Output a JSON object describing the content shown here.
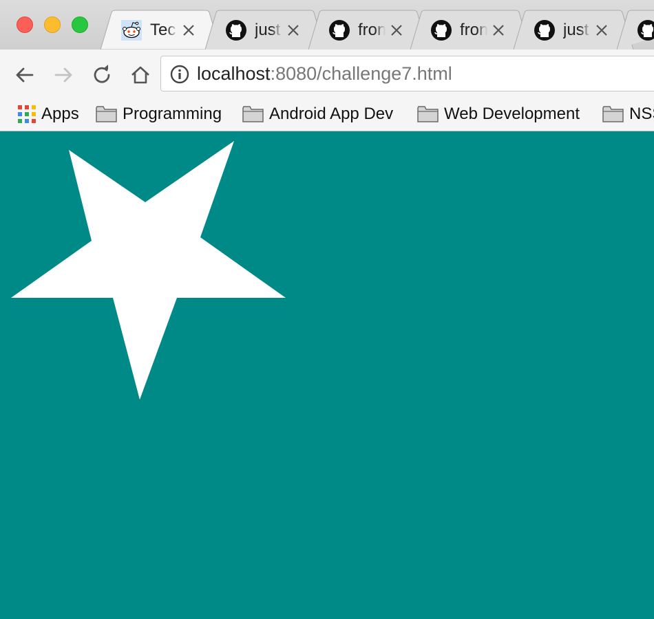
{
  "browser": {
    "tabs": [
      {
        "title": "Tec",
        "favicon": "reddit-icon",
        "active": true
      },
      {
        "title": "just",
        "favicon": "github-icon"
      },
      {
        "title": "fron",
        "favicon": "github-icon"
      },
      {
        "title": "fron",
        "favicon": "github-icon"
      },
      {
        "title": "just",
        "favicon": "github-icon"
      },
      {
        "title": "",
        "favicon": "github-icon"
      }
    ],
    "address_bar": {
      "host": "localhost",
      "path": ":8080/challenge7.html",
      "icon": "info-icon"
    },
    "nav_icons": [
      "back-arrow-icon",
      "forward-arrow-icon",
      "reload-icon",
      "home-icon"
    ],
    "bookmarks": [
      {
        "label": "Apps",
        "icon": "apps-grid-icon"
      },
      {
        "label": "Programming",
        "icon": "folder-icon"
      },
      {
        "label": "Android App Dev",
        "icon": "folder-icon"
      },
      {
        "label": "Web Development",
        "icon": "folder-icon"
      },
      {
        "label": "NSS",
        "icon": "folder-icon"
      }
    ]
  },
  "page": {
    "background_color": "#008a87",
    "star_color": "#ffffff"
  }
}
